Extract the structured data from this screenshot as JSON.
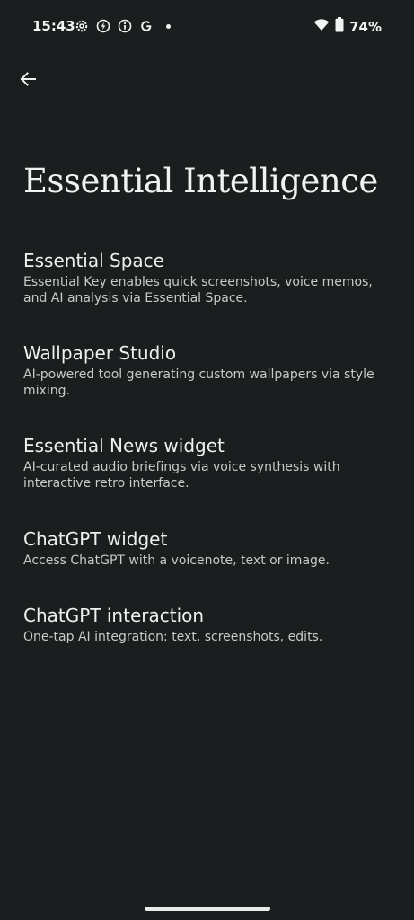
{
  "status_bar": {
    "time": "15:43",
    "battery": "74%",
    "icons": [
      "settings-gear-icon",
      "bolt-icon",
      "info-icon",
      "google-g-icon",
      "notification-dot-icon",
      "wifi-icon",
      "battery-icon"
    ]
  },
  "header": {
    "back_icon": "arrow-left-icon",
    "title": "Essential Intelligence"
  },
  "items": [
    {
      "title": "Essential Space",
      "desc": "Essential Key enables quick screenshots, voice memos, and AI analysis via Essential Space."
    },
    {
      "title": "Wallpaper Studio",
      "desc": "AI-powered tool generating custom wallpapers via style mixing."
    },
    {
      "title": "Essential News widget",
      "desc": "AI-curated audio briefings via voice synthesis with interactive retro interface."
    },
    {
      "title": "ChatGPT widget",
      "desc": "Access ChatGPT with a voicenote, text or image."
    },
    {
      "title": "ChatGPT interaction",
      "desc": "One-tap AI integration: text, screenshots, edits."
    }
  ],
  "colors": {
    "background": "#1a1e1e",
    "text_primary": "#eef1ef",
    "text_secondary": "#c6cbc8"
  }
}
